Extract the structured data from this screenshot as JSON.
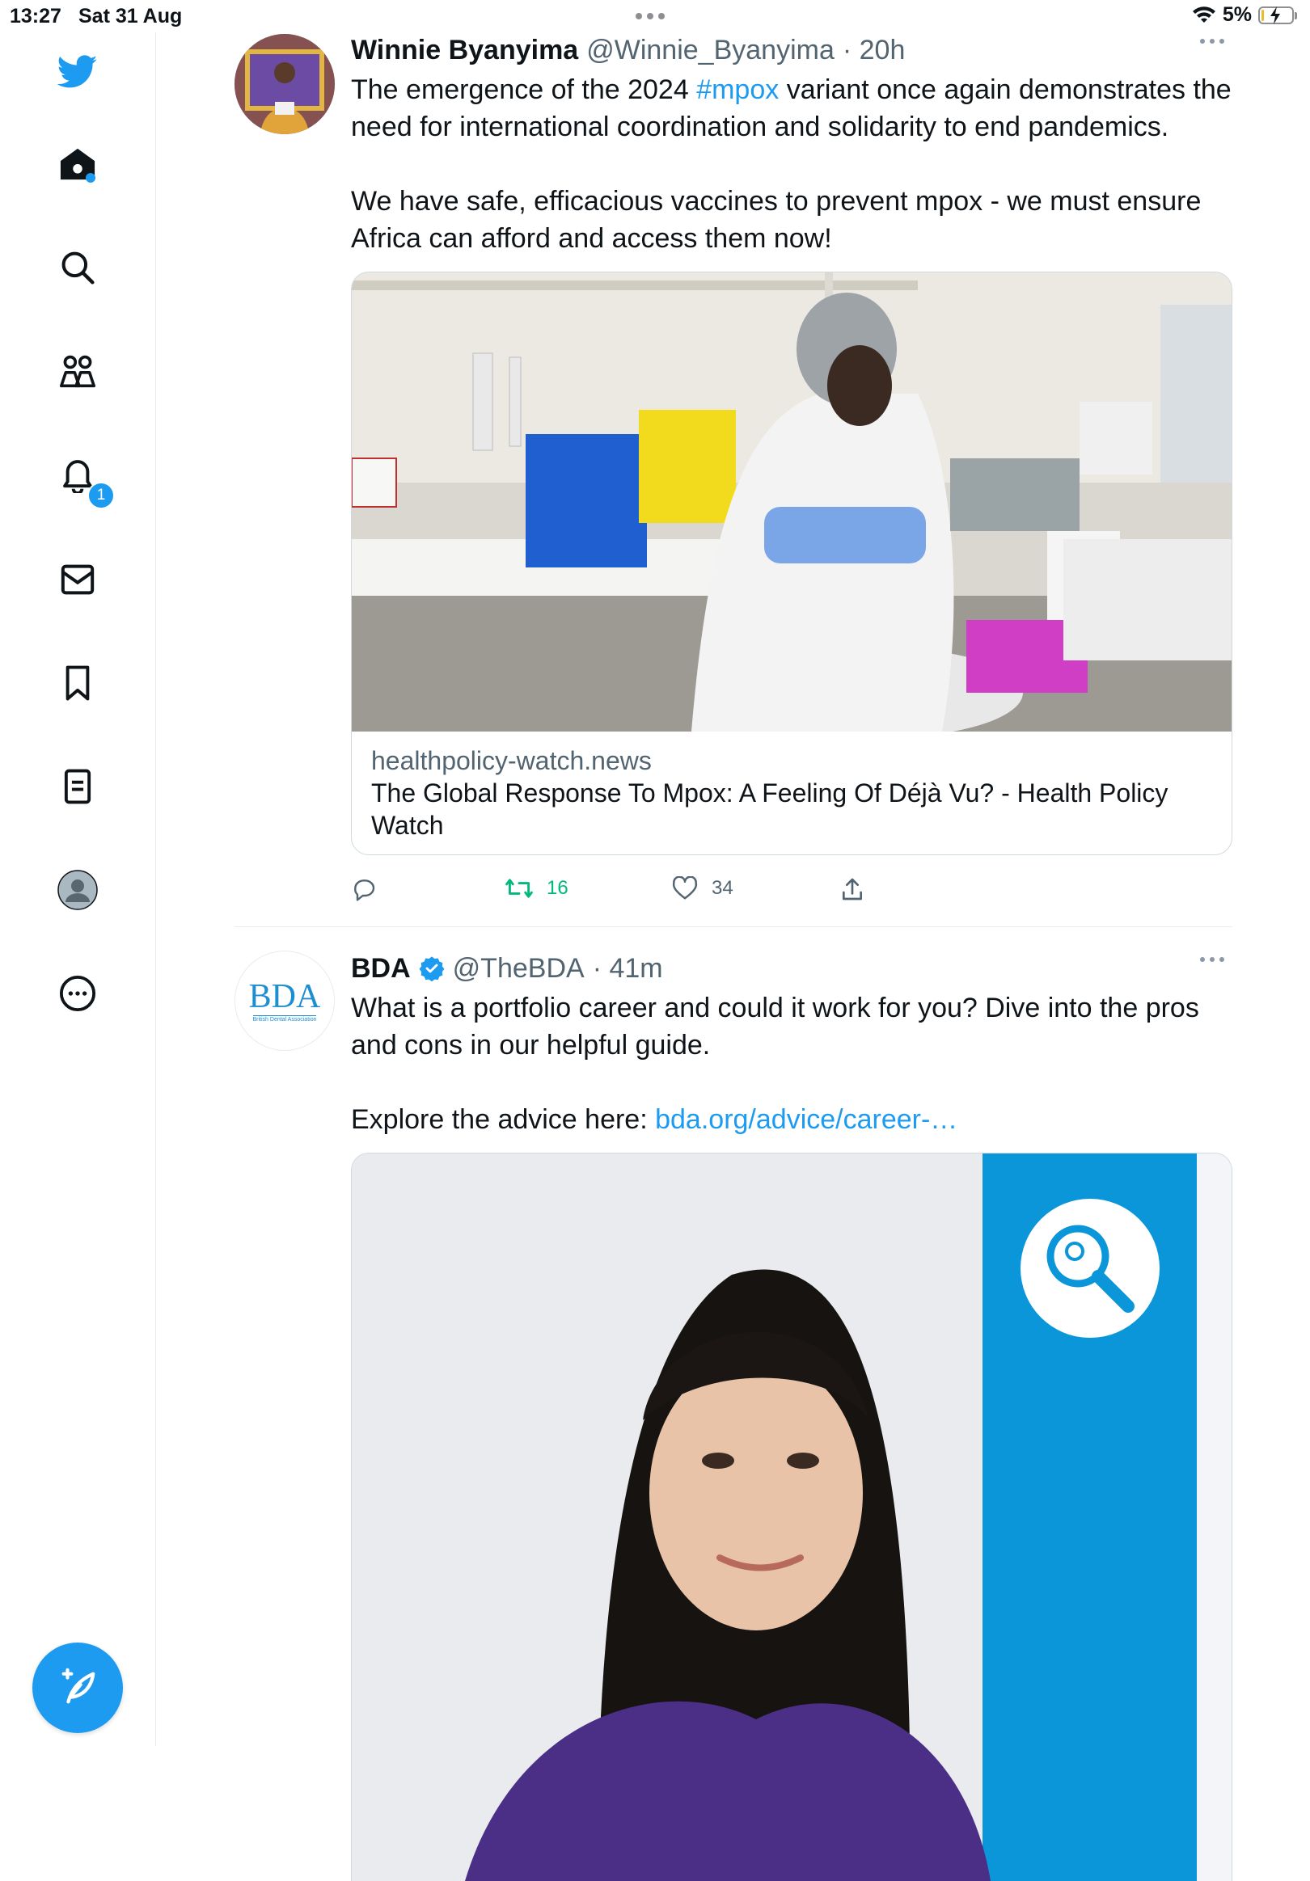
{
  "status_bar": {
    "time": "13:27",
    "date": "Sat 31 Aug",
    "battery": "5%"
  },
  "sidebar": {
    "items": [
      {
        "icon": "twitter-logo-icon"
      },
      {
        "icon": "home-icon"
      },
      {
        "icon": "search-icon"
      },
      {
        "icon": "communities-icon"
      },
      {
        "icon": "notifications-icon"
      },
      {
        "icon": "messages-icon"
      },
      {
        "icon": "bookmarks-icon"
      },
      {
        "icon": "lists-icon"
      },
      {
        "icon": "profile-icon"
      },
      {
        "icon": "more-icon"
      }
    ],
    "notification_count": "1",
    "compose_icon": "compose-tweet-icon"
  },
  "tweets": [
    {
      "name": "Winnie Byanyima",
      "handle": "@Winnie_Byanyima",
      "time": "· 20h",
      "text_line1_before": "The emergence of the 2024 ",
      "hashtag": "#mpox",
      "text_line1_after": " variant once again demonstrates the need for international coordination and solidarity to end pandemics.",
      "text_para2": "We have safe, efficacious vaccines to prevent mpox - we must ensure Africa can afford and access them now!",
      "card": {
        "domain": "healthpolicy-watch.news",
        "title": "The Global Response To Mpox: A Feeling Of Déjà Vu?   - Health Policy Watch"
      },
      "retweets": "16",
      "likes": "34"
    },
    {
      "name": "BDA",
      "verified": true,
      "handle": "@TheBDA",
      "time": "· 41m",
      "text_para1": "What is a portfolio career and could it work for you? Dive into the pros and cons in our helpful guide.",
      "text_para2_before": "Explore the advice here: ",
      "link": "bda.org/advice/career-…",
      "avatar_logo": "BDA",
      "avatar_sub": "British Dental Association"
    }
  ],
  "colors": {
    "accent": "#1d9bf0",
    "retweet_green": "#00ba7c",
    "text": "#0f1419",
    "muted": "#536471"
  }
}
